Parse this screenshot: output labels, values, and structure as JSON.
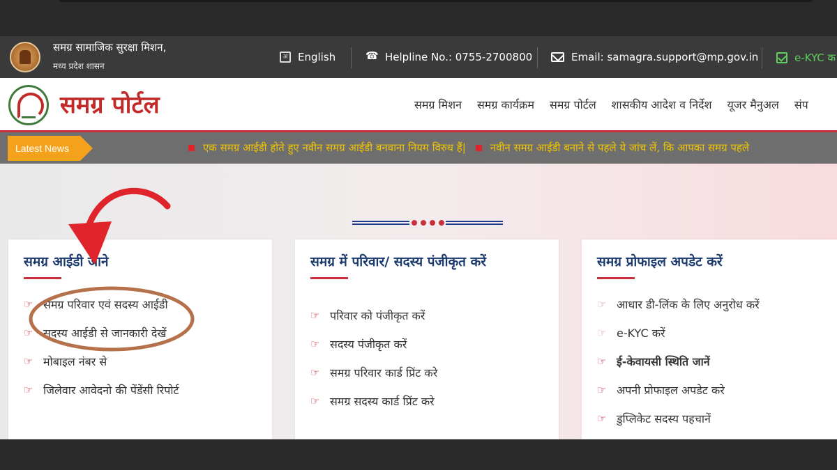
{
  "header": {
    "org_name": "समग्र सामाजिक सुरक्षा मिशन,",
    "org_sub": "मध्य प्रदेश शासन",
    "language": "English",
    "helpline": "Helpline No.: 0755-2700800",
    "email": "Email: samagra.support@mp.gov.in",
    "ekyc": "e-KYC क"
  },
  "nav": {
    "portal_title": "समग्र पोर्टल",
    "items": [
      "समग्र मिशन",
      "समग्र कार्यक्रम",
      "समग्र पोर्टल",
      "शासकीय आदेश व निर्देश",
      "यूजर मैनुअल",
      "संप"
    ]
  },
  "ticker": {
    "tag": "Latest News",
    "items": [
      "एक समग्र आईडी होते हुए नवीन समग्र आईडी बनवाना नियम विरुध हैं|",
      "नवीन समग्र आईडी बनाने से पहले ये जांच लें, कि आपका समग्र पहले"
    ]
  },
  "cards": [
    {
      "title": "समग्र आईडी जाने",
      "items": [
        "समग्र परिवार एवं सदस्य आईडी",
        "सदस्य आईडी से जानकारी देखें",
        "मोबाइल नंबर से",
        "जिलेवार आवेदनो की पेंडेंसी रिपोर्ट"
      ]
    },
    {
      "title": "समग्र में परिवार/ सदस्य पंजीकृत करें",
      "items": [
        "परिवार को पंजीकृत करें",
        "सदस्य पंजीकृत करें",
        "समग्र परिवार कार्ड प्रिंट करे",
        "समग्र सदस्य कार्ड प्रिंट करे"
      ]
    },
    {
      "title": "समग्र प्रोफाइल अपडेट करें",
      "items": [
        "आधार डी-लिंक के लिए अनुरोध करें",
        "e-KYC करें",
        "ई-केवायसी स्थिति जानें",
        "अपनी प्रोफाइल अपडेट करे",
        "डुप्लिकेट सदस्य पहचानें"
      ]
    }
  ],
  "colors": {
    "accent_red": "#c9303d",
    "title_blue": "#1c3a6e",
    "ticker_yellow": "#f0c400",
    "tag_orange": "#f4a21c",
    "annotation_arrow": "#e0242b",
    "annotation_ellipse": "#b5724a"
  },
  "icons": {
    "list_bullet": "pointing-hand-icon",
    "language": "translate-icon",
    "phone": "phone-icon",
    "email": "envelope-icon",
    "ekyc": "check-square-icon"
  }
}
